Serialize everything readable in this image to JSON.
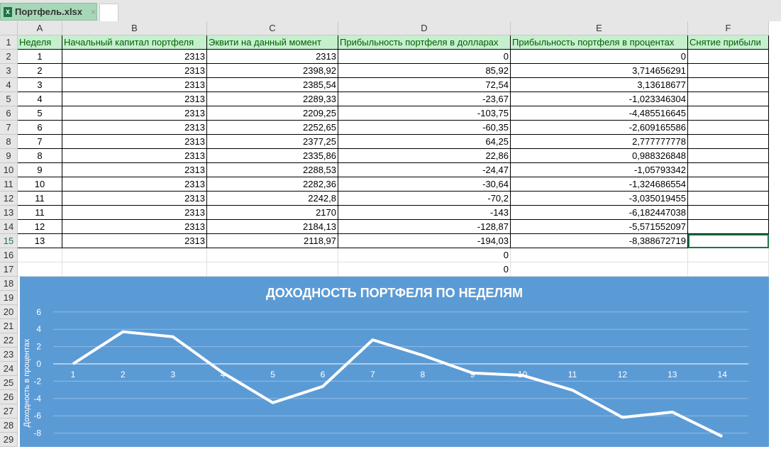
{
  "tab": {
    "title": "Портфель.xlsx",
    "close": "×"
  },
  "columns": [
    "A",
    "B",
    "C",
    "D",
    "E",
    "F"
  ],
  "headers": [
    "Неделя",
    "Начальный капитал портфеля",
    "Эквити на данный момент",
    "Прибыльность портфеля в долларах",
    "Прибыльность портфеля в процентах",
    "Снятие прибыли"
  ],
  "rows": [
    [
      "1",
      "2313",
      "2313",
      "0",
      "0",
      ""
    ],
    [
      "2",
      "2313",
      "2398,92",
      "85,92",
      "3,714656291",
      ""
    ],
    [
      "3",
      "2313",
      "2385,54",
      "72,54",
      "3,13618677",
      ""
    ],
    [
      "4",
      "2313",
      "2289,33",
      "-23,67",
      "-1,023346304",
      ""
    ],
    [
      "5",
      "2313",
      "2209,25",
      "-103,75",
      "-4,485516645",
      ""
    ],
    [
      "6",
      "2313",
      "2252,65",
      "-60,35",
      "-2,609165586",
      ""
    ],
    [
      "7",
      "2313",
      "2377,25",
      "64,25",
      "2,777777778",
      ""
    ],
    [
      "8",
      "2313",
      "2335,86",
      "22,86",
      "0,988326848",
      ""
    ],
    [
      "9",
      "2313",
      "2288,53",
      "-24,47",
      "-1,05793342",
      ""
    ],
    [
      "10",
      "2313",
      "2282,36",
      "-30,64",
      "-1,324686554",
      ""
    ],
    [
      "11",
      "2313",
      "2242,8",
      "-70,2",
      "-3,035019455",
      ""
    ],
    [
      "11",
      "2313",
      "2170",
      "-143",
      "-6,182447038",
      ""
    ],
    [
      "12",
      "2313",
      "2184,13",
      "-128,87",
      "-5,571552097",
      ""
    ],
    [
      "13",
      "2313",
      "2118,97",
      "-194,03",
      "-8,388672719",
      ""
    ],
    [
      "",
      "",
      "",
      "0",
      "",
      ""
    ],
    [
      "",
      "",
      "",
      "0",
      "",
      ""
    ]
  ],
  "row_numbers": [
    "1",
    "2",
    "3",
    "4",
    "5",
    "6",
    "7",
    "8",
    "9",
    "10",
    "11",
    "12",
    "13",
    "14",
    "15",
    "16",
    "17",
    "18",
    "19",
    "20",
    "21",
    "22",
    "23",
    "24",
    "25",
    "26",
    "27",
    "28",
    "29"
  ],
  "chart_data": {
    "type": "line",
    "title": "ДОХОДНОСТЬ ПОРТФЕЛЯ ПО НЕДЕЛЯМ",
    "ylabel": "Доходность в процентах",
    "xlabel": "",
    "categories": [
      "1",
      "2",
      "3",
      "4",
      "5",
      "6",
      "7",
      "8",
      "9",
      "10",
      "11",
      "12",
      "13",
      "14"
    ],
    "values": [
      0,
      3.714656291,
      3.13618677,
      -1.023346304,
      -4.485516645,
      -2.609165586,
      2.777777778,
      0.988326848,
      -1.05793342,
      -1.324686554,
      -3.035019455,
      -6.182447038,
      -5.571552097,
      -8.388672719
    ],
    "yticks": [
      "6",
      "4",
      "2",
      "0",
      "-2",
      "-4",
      "-6",
      "-8"
    ],
    "ylim": [
      -8,
      6
    ],
    "grid": true,
    "colors": {
      "background": "#5b9bd5",
      "line": "#ffffff"
    }
  }
}
